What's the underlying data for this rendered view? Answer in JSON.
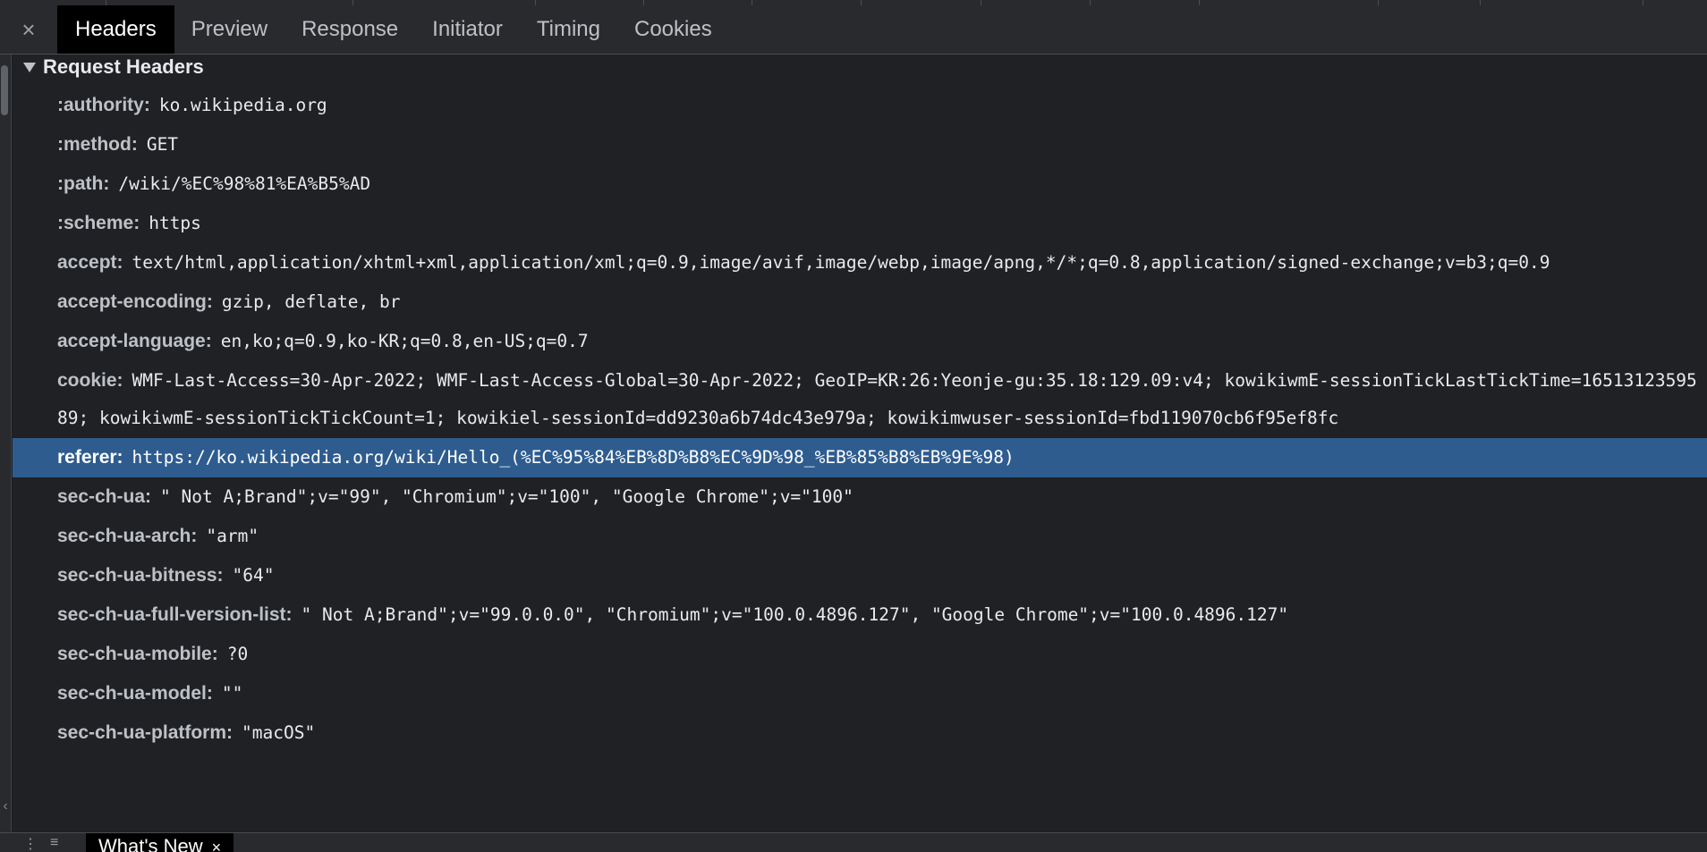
{
  "tabs": {
    "close_symbol": "×",
    "items": [
      "Headers",
      "Preview",
      "Response",
      "Initiator",
      "Timing",
      "Cookies"
    ],
    "active": "Headers"
  },
  "section": {
    "title": "Request Headers"
  },
  "headers": [
    {
      "name": ":authority:",
      "value": "ko.wikipedia.org"
    },
    {
      "name": ":method:",
      "value": "GET"
    },
    {
      "name": ":path:",
      "value": "/wiki/%EC%98%81%EA%B5%AD"
    },
    {
      "name": ":scheme:",
      "value": "https"
    },
    {
      "name": "accept:",
      "value": "text/html,application/xhtml+xml,application/xml;q=0.9,image/avif,image/webp,image/apng,*/*;q=0.8,application/signed-exchange;v=b3;q=0.9"
    },
    {
      "name": "accept-encoding:",
      "value": "gzip, deflate, br"
    },
    {
      "name": "accept-language:",
      "value": "en,ko;q=0.9,ko-KR;q=0.8,en-US;q=0.7"
    },
    {
      "name": "cookie:",
      "value": "WMF-Last-Access=30-Apr-2022; WMF-Last-Access-Global=30-Apr-2022; GeoIP=KR:26:Yeonje-gu:35.18:129.09:v4; kowikiwmE-sessionTickLastTickTime=1651312359589; kowikiwmE-sessionTickTickCount=1; kowikiel-sessionId=dd9230a6b74dc43e979a; kowikimwuser-sessionId=fbd119070cb6f95ef8fc"
    },
    {
      "name": "referer:",
      "value": "https://ko.wikipedia.org/wiki/Hello_(%EC%95%84%EB%8D%B8%EC%9D%98_%EB%85%B8%EB%9E%98)"
    },
    {
      "name": "sec-ch-ua:",
      "value": "\" Not A;Brand\";v=\"99\", \"Chromium\";v=\"100\", \"Google Chrome\";v=\"100\""
    },
    {
      "name": "sec-ch-ua-arch:",
      "value": "\"arm\""
    },
    {
      "name": "sec-ch-ua-bitness:",
      "value": "\"64\""
    },
    {
      "name": "sec-ch-ua-full-version-list:",
      "value": "\" Not A;Brand\";v=\"99.0.0.0\", \"Chromium\";v=\"100.0.4896.127\", \"Google Chrome\";v=\"100.0.4896.127\""
    },
    {
      "name": "sec-ch-ua-mobile:",
      "value": "?0"
    },
    {
      "name": "sec-ch-ua-model:",
      "value": "\"\""
    },
    {
      "name": "sec-ch-ua-platform:",
      "value": "\"macOS\""
    }
  ],
  "bottom": {
    "drawer_tab": "What's New",
    "close_symbol": "×"
  },
  "colors": {
    "background": "#202124",
    "selected_row": "#2e5c8f",
    "active_tab": "#000000"
  }
}
